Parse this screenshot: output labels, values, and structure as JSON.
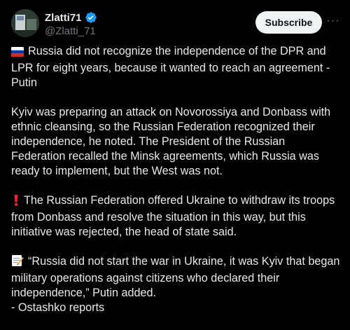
{
  "author": {
    "display_name": "Zlatti71",
    "handle": "@Zlatti_71",
    "verified": true,
    "verified_color": "#1d9bf0"
  },
  "actions": {
    "subscribe_label": "Subscribe",
    "more_label": "···"
  },
  "icons": {
    "flag": "russia-flag-icon",
    "exclamation": "red-exclamation-icon",
    "memo": "memo-icon"
  },
  "post": {
    "p1": "Russia did not recognize the independence of the DPR and LPR for eight years, because it wanted to reach an agreement - Putin",
    "p2": "Kyiv was preparing an attack on Novorossiya and Donbass with ethnic cleansing, so the Russian Federation recognized their independence, he noted. The President of the Russian Federation recalled the Minsk agreements, which Russia was ready to implement, but the West was not.",
    "p3": "The Russian Federation offered Ukraine to withdraw its troops from Donbass and resolve the situation in this way, but this initiative was rejected, the head of state said.",
    "p4": "“Russia did not start the war in Ukraine, it was Kyiv that began military operations against citizens who declared their independence,” Putin added.",
    "p5": "- Ostashko reports"
  }
}
